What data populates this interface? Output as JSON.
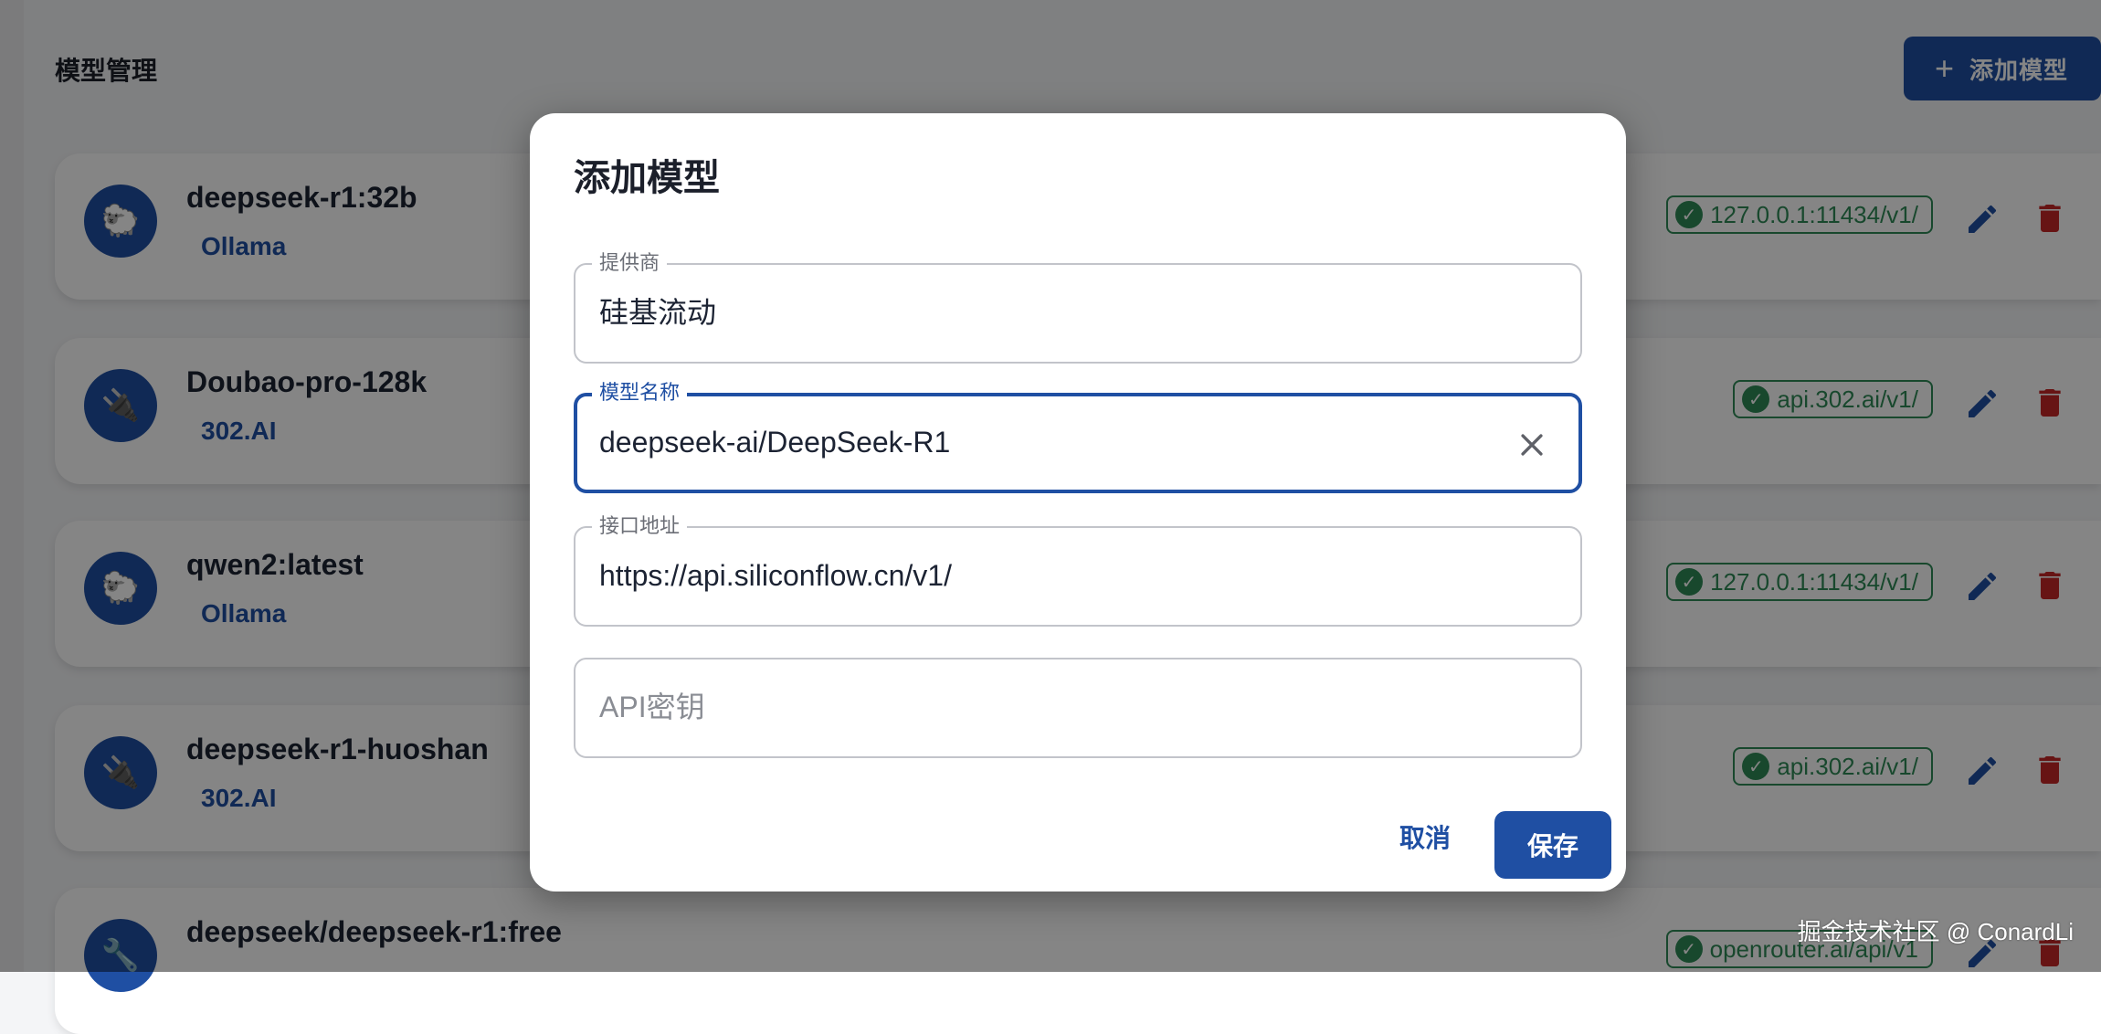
{
  "page": {
    "title": "模型管理",
    "add_button_label": "添加模型"
  },
  "models": [
    {
      "name": "deepseek-r1:32b",
      "provider": "Ollama",
      "icon": "sheep-icon",
      "endpoint": "127.0.0.1:11434/v1/"
    },
    {
      "name": "Doubao-pro-128k",
      "provider": "302.AI",
      "icon": "plug-icon",
      "endpoint": "api.302.ai/v1/"
    },
    {
      "name": "qwen2:latest",
      "provider": "Ollama",
      "icon": "sheep-icon",
      "endpoint": "127.0.0.1:11434/v1/"
    },
    {
      "name": "deepseek-r1-huoshan",
      "provider": "302.AI",
      "icon": "plug-icon",
      "endpoint": "api.302.ai/v1/"
    },
    {
      "name": "deepseek/deepseek-r1:free",
      "provider": "",
      "icon": "wrench-icon",
      "endpoint": "openrouter.ai/api/v1"
    }
  ],
  "dialog": {
    "title": "添加模型",
    "provider_label": "提供商",
    "provider_value": "硅基流动",
    "model_label": "模型名称",
    "model_value": "deepseek-ai/DeepSeek-R1",
    "endpoint_label": "接口地址",
    "endpoint_value": "https://api.siliconflow.cn/v1/",
    "api_key_placeholder": "API密钥",
    "cancel_label": "取消",
    "save_label": "保存"
  },
  "watermark": "掘金技术社区 @ ConardLi",
  "colors": {
    "primary": "#1f4fa3",
    "success": "#2e8b57",
    "danger": "#c62828",
    "overlay": "rgba(0,0,0,0.48)"
  }
}
